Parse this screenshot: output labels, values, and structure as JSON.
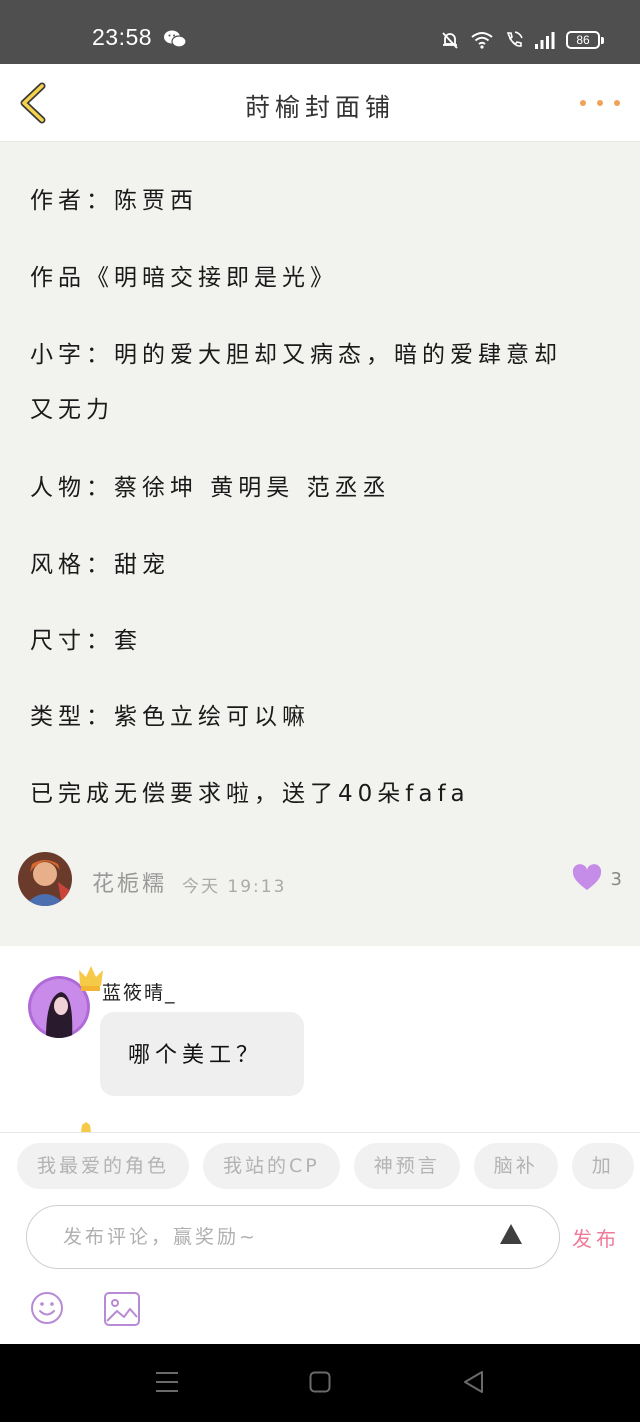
{
  "status_bar": {
    "time": "23:58",
    "battery": "86"
  },
  "header": {
    "title": "莳榆封面铺"
  },
  "post": {
    "lines": [
      "作者：陈贾西",
      "作品《明暗交接即是光》",
      "小字：明的爱大胆却又病态，暗的爱肆意却",
      "又无力",
      "人物：蔡徐坤 黄明昊 范丞丞",
      "风格：甜宠",
      "尺寸：套",
      "类型：紫色立绘可以嘛",
      "已完成无偿要求啦，送了40朵fafa"
    ],
    "author": {
      "name": "花栀糯",
      "time": "今天 19:13"
    },
    "likes": "3"
  },
  "comment": {
    "name": "蓝筱晴_",
    "text": "哪个美工？"
  },
  "input_panel": {
    "chips": [
      "我最爱的角色",
      "我站的CP",
      "神预言",
      "脑补",
      "加"
    ],
    "placeholder": "发布评论，赢奖励~",
    "publish_label": "发布"
  },
  "colors": {
    "accent_orange": "#f2a15a",
    "like_purple": "#c58ce8",
    "publish_pink": "#f07a9a"
  },
  "icons": [
    "wechat-icon",
    "mute-bell-icon",
    "wifi-icon",
    "wifi-call-icon",
    "signal-icon",
    "battery-icon",
    "back-chevron-icon",
    "more-dots-icon",
    "heart-icon",
    "crown-icon",
    "send-arrow-icon",
    "emoji-icon",
    "image-icon"
  ]
}
